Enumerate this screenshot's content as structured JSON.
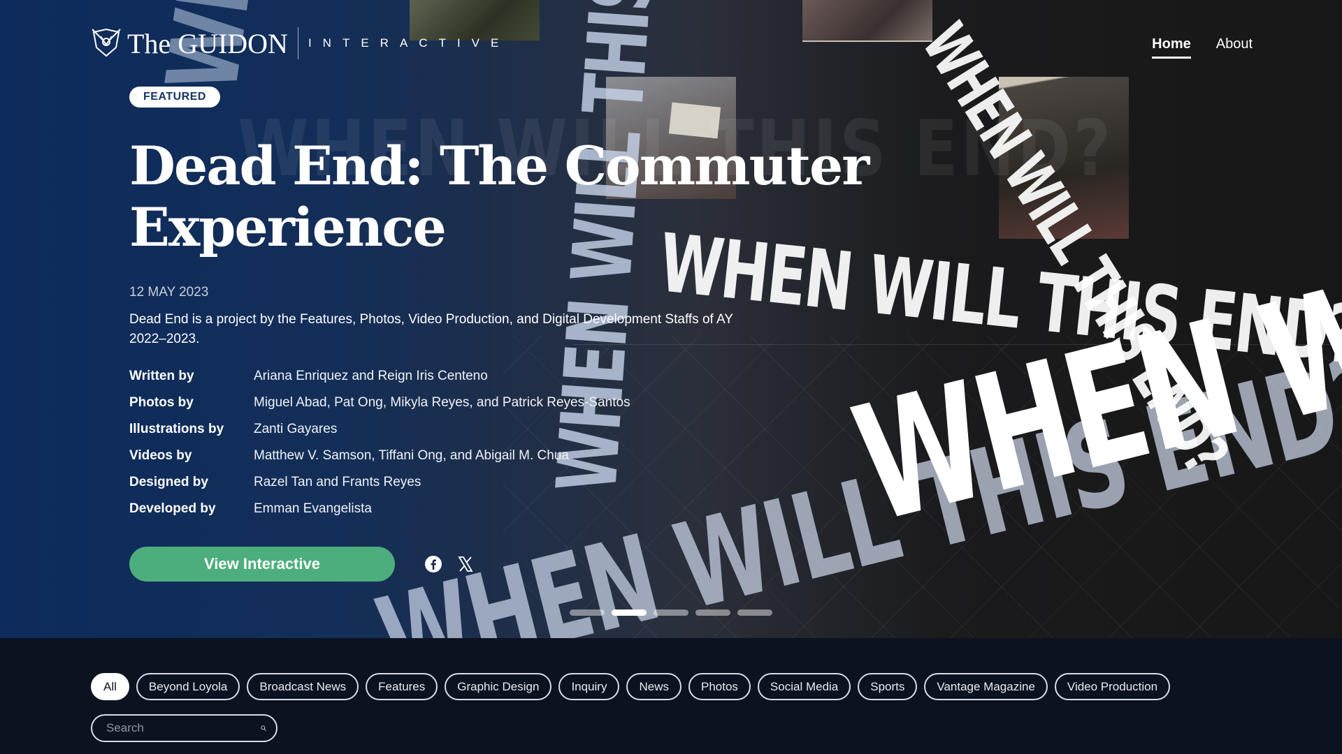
{
  "brand": {
    "name": "The GUIDON",
    "subtitle": "INTERACTIVE"
  },
  "nav": {
    "items": [
      {
        "label": "Home",
        "active": true
      },
      {
        "label": "About",
        "active": false
      }
    ]
  },
  "hero": {
    "badge": "FEATURED",
    "title": "Dead End: The Commuter Experience",
    "date": "12 MAY 2023",
    "description": "Dead End is a project by the Features, Photos, Video Production, and Digital Development Staffs of AY 2022–2023.",
    "background_text": "WHEN WILL THIS END?",
    "credits": [
      {
        "label": "Written by",
        "value": "Ariana Enriquez and Reign Iris Centeno"
      },
      {
        "label": "Photos by",
        "value": "Miguel Abad, Pat Ong, Mikyla Reyes, and Patrick Reyes-Santos"
      },
      {
        "label": "Illustrations by",
        "value": "Zanti Gayares"
      },
      {
        "label": "Videos by",
        "value": "Matthew V. Samson, Tiffani Ong, and Abigail M. Chua"
      },
      {
        "label": "Designed by",
        "value": "Razel Tan and Frants Reyes"
      },
      {
        "label": "Developed by",
        "value": "Emman Evangelista"
      }
    ],
    "cta_label": "View Interactive",
    "social": [
      "facebook-icon",
      "x-icon"
    ],
    "carousel": {
      "count": 5,
      "active_index": 1
    }
  },
  "filters": {
    "chips": [
      "All",
      "Beyond Loyola",
      "Broadcast News",
      "Features",
      "Graphic Design",
      "Inquiry",
      "News",
      "Photos",
      "Social Media",
      "Sports",
      "Vantage Magazine",
      "Video Production"
    ],
    "active": "All",
    "search_placeholder": "Search"
  },
  "colors": {
    "cta": "#4cae7c",
    "badge_text": "#163566",
    "page_bg": "#0b1220"
  }
}
